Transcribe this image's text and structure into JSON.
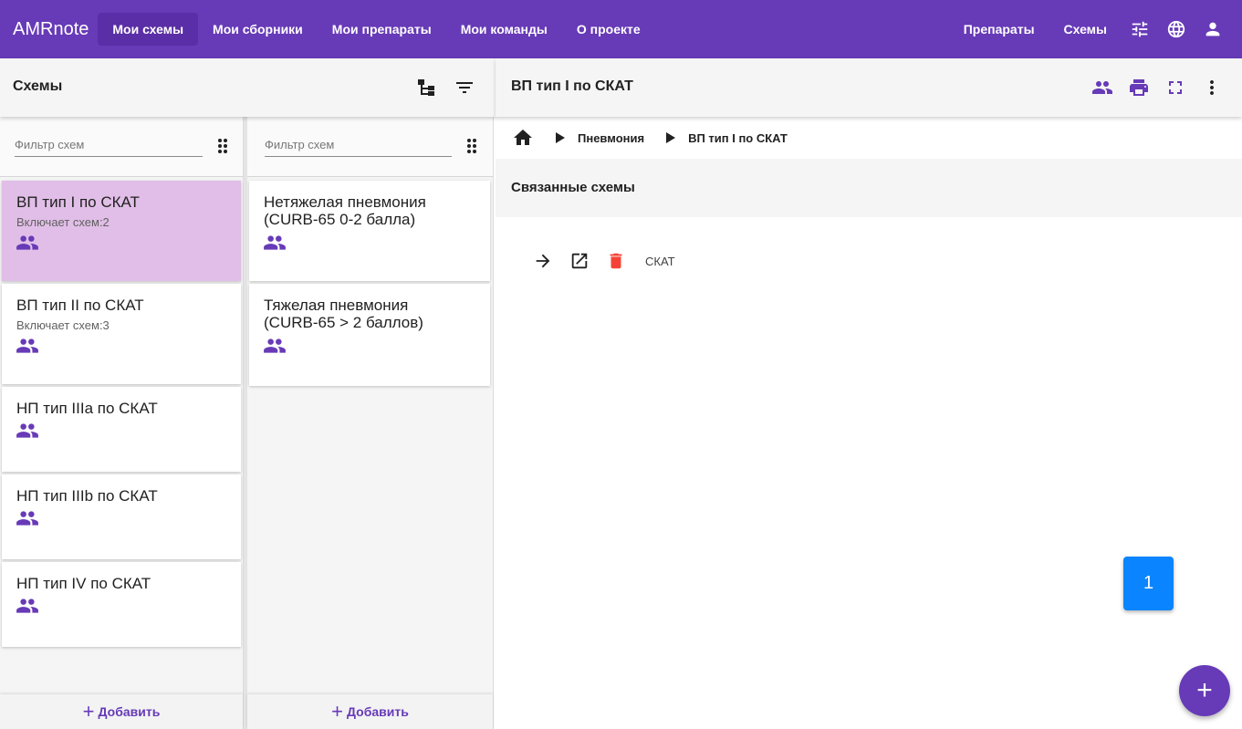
{
  "app": {
    "brand": "AMRnote"
  },
  "nav": {
    "items": [
      "Мои схемы",
      "Мои сборники",
      "Мои препараты",
      "Мои команды",
      "О проекте"
    ],
    "active_index": 0,
    "right_items": [
      "Препараты",
      "Схемы"
    ],
    "icons": [
      "tune-icon",
      "globe-icon",
      "account-icon"
    ]
  },
  "left_toolbar": {
    "title": "Схемы",
    "icons": [
      "tree-icon",
      "filter-icon"
    ]
  },
  "right_toolbar": {
    "title": "ВП тип I по СКАТ",
    "icons": [
      "group-icon",
      "print-icon",
      "fullscreen-icon",
      "more-vert-icon"
    ]
  },
  "col1": {
    "filter_placeholder": "Фильтр схем",
    "cards": [
      {
        "title": "ВП тип I по СКАТ",
        "subtitle": "Включает схем:2",
        "selected": true
      },
      {
        "title": "ВП тип II по СКАТ",
        "subtitle": "Включает схем:3",
        "selected": false
      },
      {
        "title": "НП тип IIIa по СКАТ",
        "subtitle": "",
        "selected": false
      },
      {
        "title": "НП тип IIIb по СКАТ",
        "subtitle": "",
        "selected": false
      },
      {
        "title": "НП тип IV по СКАТ",
        "subtitle": "",
        "selected": false
      }
    ],
    "add_label": "Добавить"
  },
  "col2": {
    "filter_placeholder": "Фильтр схем",
    "cards": [
      {
        "title_line1": "Нетяжелая пневмония",
        "title_line2": "(CURB-65 0-2 балла)"
      },
      {
        "title_line1": "Тяжелая пневмония",
        "title_line2": "(CURB-65 > 2 баллов)"
      }
    ],
    "add_label": "Добавить"
  },
  "breadcrumb": {
    "items": [
      "Пневмония",
      "ВП тип I по СКАТ"
    ]
  },
  "related": {
    "title": "Связанные схемы",
    "items": [
      {
        "label": "СКАТ"
      }
    ]
  },
  "badge": {
    "value": "1"
  },
  "fab": {
    "label": "+"
  },
  "colors": {
    "primary": "#673ab7",
    "selected": "#e1bee7",
    "danger": "#f44336",
    "badge": "#0a84ff"
  }
}
